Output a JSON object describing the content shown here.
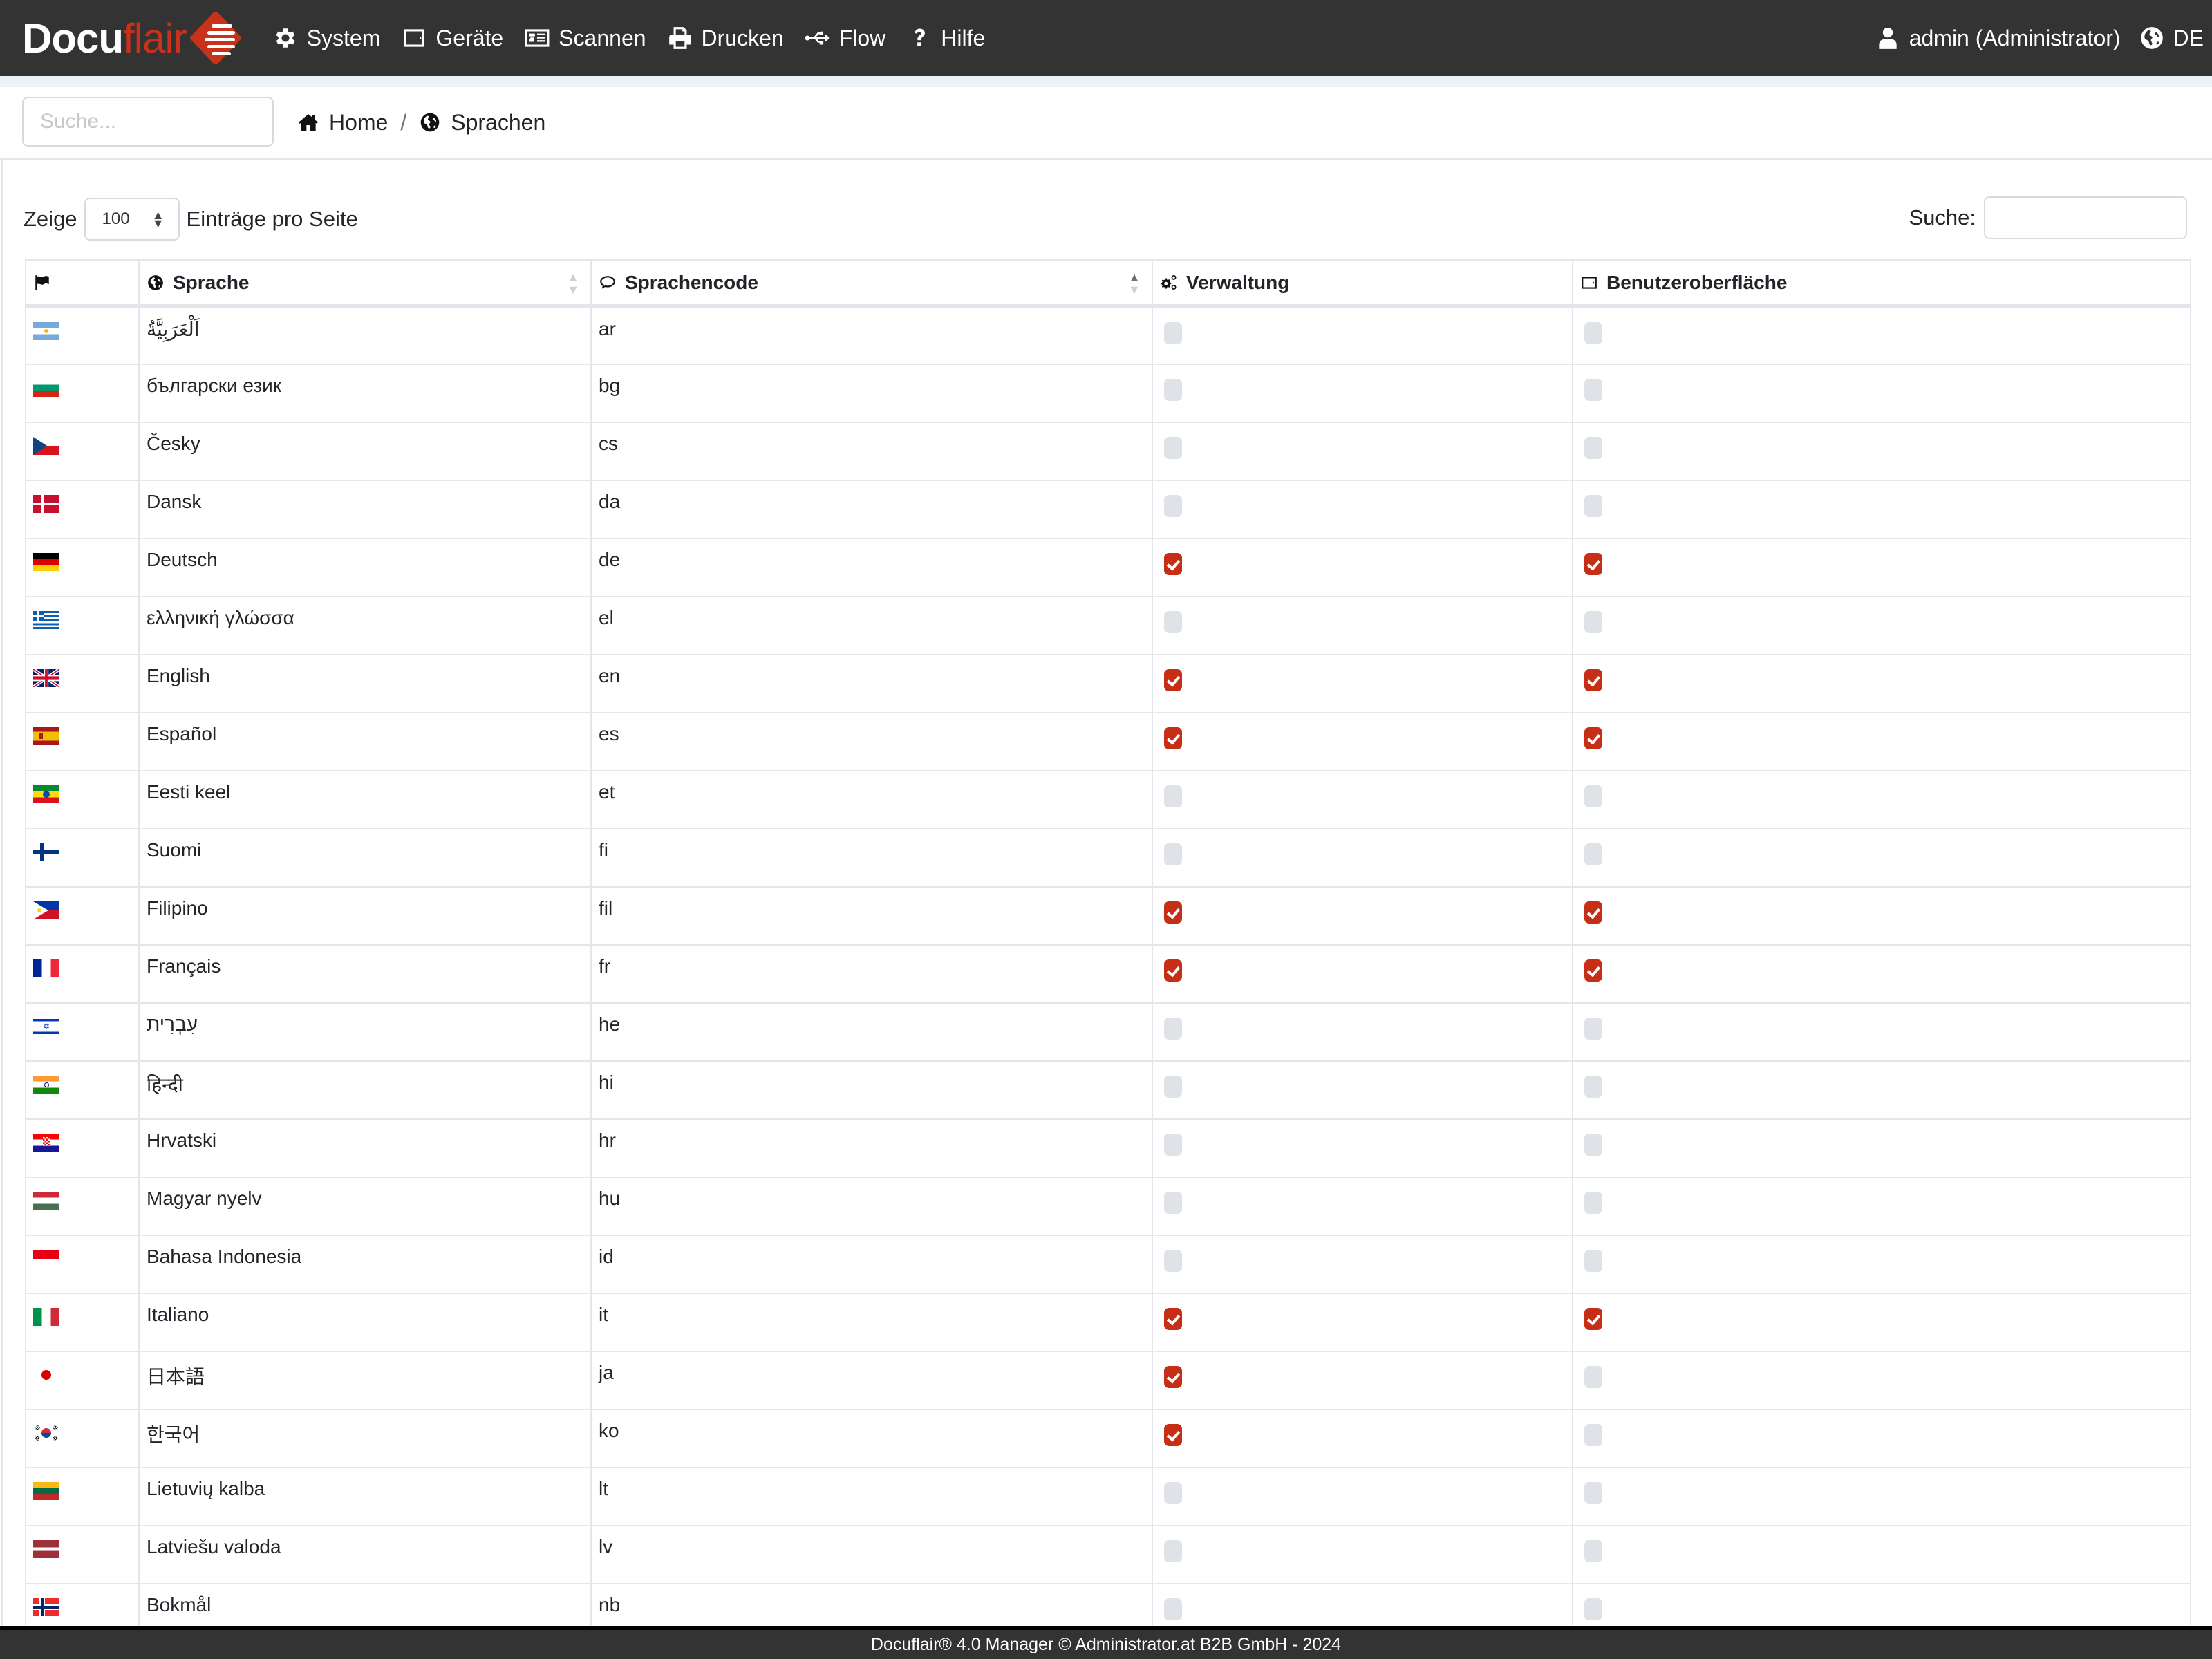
{
  "app": {
    "brand_primary": "Docu",
    "brand_accent": "flair",
    "accent_color": "#c8321a"
  },
  "nav": {
    "items": [
      {
        "label": "System",
        "icon": "gear-icon"
      },
      {
        "label": "Geräte",
        "icon": "tablet-icon"
      },
      {
        "label": "Scannen",
        "icon": "scanner-icon"
      },
      {
        "label": "Drucken",
        "icon": "printer-icon"
      },
      {
        "label": "Flow",
        "icon": "usb-flow-icon"
      },
      {
        "label": "Hilfe",
        "icon": "question-icon"
      }
    ],
    "user_label": "admin (Administrator)",
    "language_label": "DE"
  },
  "toolbar": {
    "search_placeholder": "Suche...",
    "breadcrumb": [
      {
        "label": "Home",
        "icon": "home-icon"
      },
      {
        "label": "Sprachen",
        "icon": "globe-icon"
      }
    ],
    "breadcrumb_separator": "/"
  },
  "table_controls": {
    "show_label": "Zeige",
    "page_length": "100",
    "per_page_label": "Einträge pro Seite",
    "search_label": "Suche:",
    "search_value": ""
  },
  "table": {
    "columns": [
      {
        "label": "",
        "icon": "flag-icon"
      },
      {
        "label": "Sprache",
        "icon": "globe-icon",
        "sort": "none"
      },
      {
        "label": "Sprachencode",
        "icon": "comments-icon",
        "sort": "asc"
      },
      {
        "label": "Verwaltung",
        "icon": "cogs-icon"
      },
      {
        "label": "Benutzeroberfläche",
        "icon": "window-icon"
      }
    ],
    "rows": [
      {
        "flag": "ar",
        "name": "اَلْعَرَبِيَّةُ",
        "code": "ar",
        "admin": false,
        "ui": false
      },
      {
        "flag": "bg",
        "name": "български език",
        "code": "bg",
        "admin": false,
        "ui": false
      },
      {
        "flag": "cz",
        "name": "Česky",
        "code": "cs",
        "admin": false,
        "ui": false
      },
      {
        "flag": "dk",
        "name": "Dansk",
        "code": "da",
        "admin": false,
        "ui": false
      },
      {
        "flag": "de",
        "name": "Deutsch",
        "code": "de",
        "admin": true,
        "ui": true
      },
      {
        "flag": "gr",
        "name": "ελληνική γλώσσα",
        "code": "el",
        "admin": false,
        "ui": false
      },
      {
        "flag": "gb",
        "name": "English",
        "code": "en",
        "admin": true,
        "ui": true
      },
      {
        "flag": "es",
        "name": "Español",
        "code": "es",
        "admin": true,
        "ui": true
      },
      {
        "flag": "et",
        "name": "Eesti keel",
        "code": "et",
        "admin": false,
        "ui": false
      },
      {
        "flag": "fi",
        "name": "Suomi",
        "code": "fi",
        "admin": false,
        "ui": false
      },
      {
        "flag": "ph",
        "name": "Filipino",
        "code": "fil",
        "admin": true,
        "ui": true
      },
      {
        "flag": "fr",
        "name": "Français",
        "code": "fr",
        "admin": true,
        "ui": true
      },
      {
        "flag": "il",
        "name": "עִבְרִית",
        "code": "he",
        "admin": false,
        "ui": false
      },
      {
        "flag": "in",
        "name": "हिन्दी",
        "code": "hi",
        "admin": false,
        "ui": false
      },
      {
        "flag": "hr",
        "name": "Hrvatski",
        "code": "hr",
        "admin": false,
        "ui": false
      },
      {
        "flag": "hu",
        "name": "Magyar nyelv",
        "code": "hu",
        "admin": false,
        "ui": false
      },
      {
        "flag": "id",
        "name": "Bahasa Indonesia",
        "code": "id",
        "admin": false,
        "ui": false
      },
      {
        "flag": "it",
        "name": "Italiano",
        "code": "it",
        "admin": true,
        "ui": true
      },
      {
        "flag": "jp",
        "name": "日本語",
        "code": "ja",
        "admin": true,
        "ui": false
      },
      {
        "flag": "kr",
        "name": "한국어",
        "code": "ko",
        "admin": true,
        "ui": false
      },
      {
        "flag": "lt",
        "name": "Lietuvių kalba",
        "code": "lt",
        "admin": false,
        "ui": false
      },
      {
        "flag": "lv",
        "name": "Latviešu valoda",
        "code": "lv",
        "admin": false,
        "ui": false
      },
      {
        "flag": "no",
        "name": "Bokmål",
        "code": "nb",
        "admin": false,
        "ui": false
      }
    ]
  },
  "footer": {
    "text": "Docuflair® 4.0 Manager © Administrator.at B2B GmbH - 2024"
  }
}
